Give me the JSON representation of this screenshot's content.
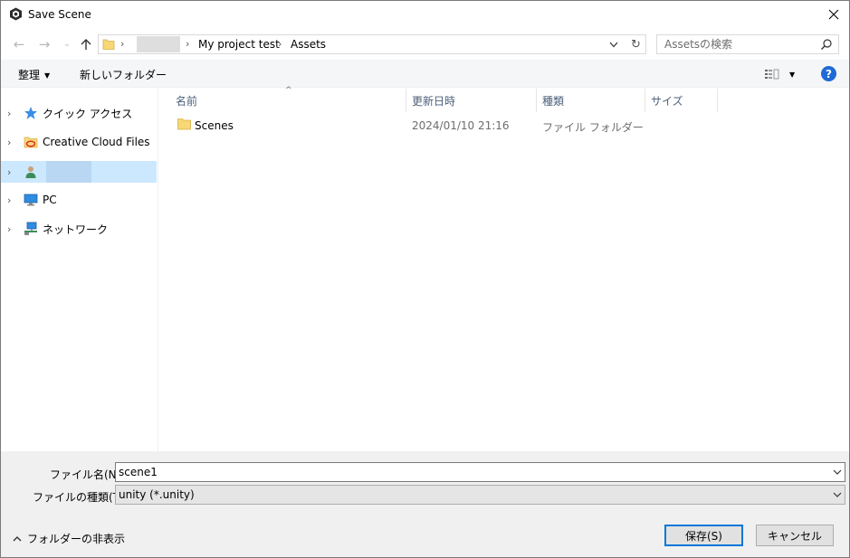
{
  "window": {
    "title": "Save Scene"
  },
  "nav": {
    "path": [
      "My project test",
      "Assets"
    ],
    "search_placeholder": "Assetsの検索"
  },
  "toolbar": {
    "organize_label": "整理",
    "new_folder_label": "新しいフォルダー",
    "help_label": "?"
  },
  "sidebar": {
    "items": [
      {
        "label": "クイック アクセス",
        "icon": "quick-access-star-icon"
      },
      {
        "label": "Creative Cloud Files",
        "icon": "creative-cloud-folder-icon"
      },
      {
        "label": "",
        "icon": "user-icon",
        "selected": true
      },
      {
        "label": "PC",
        "icon": "pc-monitor-icon"
      },
      {
        "label": "ネットワーク",
        "icon": "network-icon"
      }
    ]
  },
  "file_list": {
    "columns": [
      "名前",
      "更新日時",
      "種類",
      "サイズ"
    ],
    "rows": [
      {
        "name": "Scenes",
        "modified": "2024/01/10 21:16",
        "type": "ファイル フォルダー",
        "size": ""
      }
    ]
  },
  "bottom": {
    "filename_label": "ファイル名(N):",
    "filename_value": "scene1",
    "filetype_label": "ファイルの種類(T):",
    "filetype_value": "unity (*.unity)",
    "hide_folders_label": "フォルダーの非表示",
    "save_label": "保存(S)",
    "cancel_label": "キャンセル"
  },
  "colors": {
    "selection": "#cce8ff",
    "accent": "#0078d7",
    "help": "#1e6bd6",
    "folder": "#f8d775"
  }
}
